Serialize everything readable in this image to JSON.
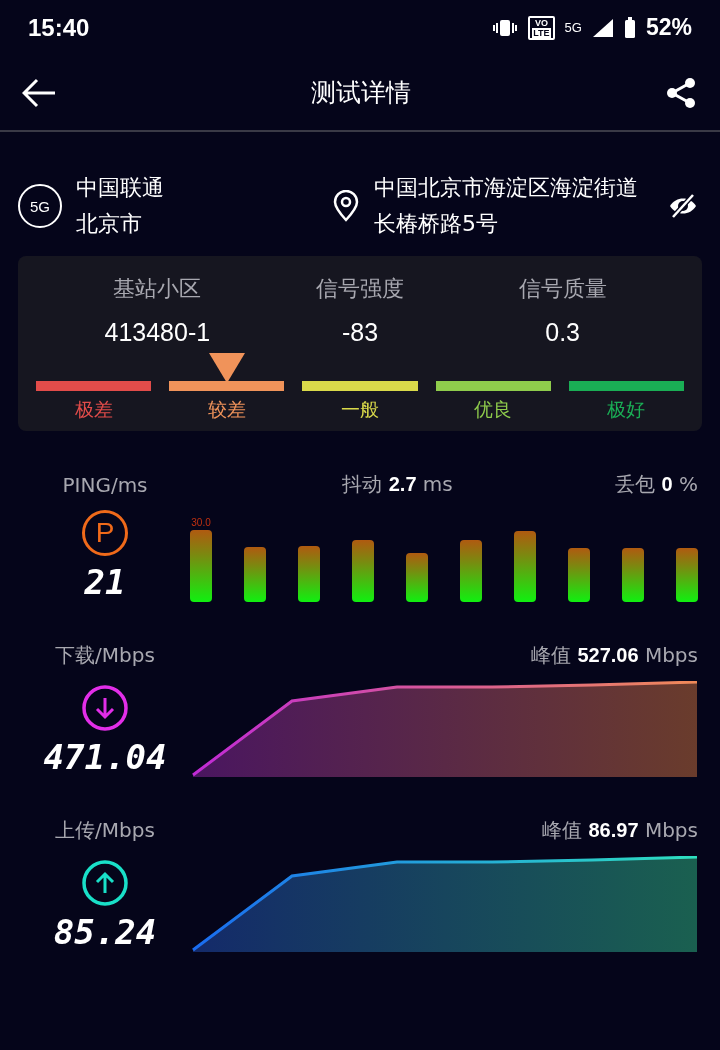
{
  "status_bar": {
    "time": "15:40",
    "volte_top": "VO",
    "volte_bottom": "LTE",
    "network": "5G",
    "battery": "52%"
  },
  "header": {
    "title": "测试详情"
  },
  "carrier": {
    "badge": "5G",
    "name": "中国联通",
    "city": "北京市"
  },
  "location": {
    "address": "中国北京市海淀区海淀街道长椿桥路5号"
  },
  "cell_info": [
    {
      "label": "基站小区",
      "value": "413480-1"
    },
    {
      "label": "信号强度",
      "value": "-83"
    },
    {
      "label": "信号质量",
      "value": "0.3"
    }
  ],
  "signal_scale": [
    {
      "label": "极差",
      "color": "#e24c4a",
      "selected": false
    },
    {
      "label": "较差",
      "color": "#f0935a",
      "selected": true
    },
    {
      "label": "一般",
      "color": "#d9d94a",
      "selected": false
    },
    {
      "label": "优良",
      "color": "#8fcc4c",
      "selected": false
    },
    {
      "label": "极好",
      "color": "#1aae55",
      "selected": false
    }
  ],
  "ping": {
    "label": "PING/ms",
    "icon_letter": "P",
    "value": "21",
    "jitter_label": "抖动",
    "jitter_value": "2.7",
    "jitter_unit": "ms",
    "loss_label": "丢包",
    "loss_value": "0",
    "loss_unit": "%",
    "peak_label": "30.0"
  },
  "speeds": [
    {
      "kind": "download",
      "label": "下载/Mbps",
      "value": "471.04",
      "peak_label": "峰值",
      "peak_value": "527.06",
      "peak_unit": "Mbps"
    },
    {
      "kind": "upload",
      "label": "上传/Mbps",
      "value": "85.24",
      "peak_label": "峰值",
      "peak_value": "86.97",
      "peak_unit": "Mbps"
    }
  ]
}
